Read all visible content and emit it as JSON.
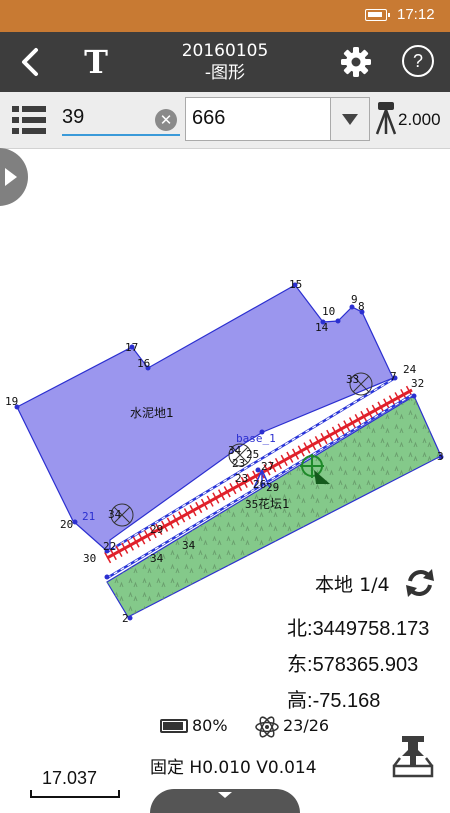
{
  "status_bar": {
    "time": "17:12"
  },
  "header": {
    "title_line1": "20160105",
    "title_line2": "-图形",
    "text_tool": "T",
    "help": "?"
  },
  "toolbar": {
    "point_name": "39",
    "code_value": "666",
    "instrument_height": "2.000"
  },
  "map": {
    "areas": [
      {
        "name": "水泥地1",
        "fill": "#9b96ee"
      },
      {
        "name": "花坛1",
        "fill": "#84c98a"
      }
    ],
    "point_labels": [
      "2",
      "3",
      "7",
      "8",
      "9",
      "10",
      "12",
      "13",
      "14",
      "15",
      "16",
      "17",
      "18",
      "19",
      "20",
      "21",
      "22",
      "23",
      "24",
      "25",
      "26",
      "27",
      "29",
      "30",
      "31",
      "32",
      "33",
      "34",
      "35"
    ],
    "base_label": "base_1",
    "colors": {
      "building": "#9b96ee",
      "garden": "#84c98a",
      "red_line": "#e0202a",
      "blue_line": "#2a36d8",
      "point": "#2b2fd0"
    }
  },
  "position": {
    "mode_label": "本地",
    "page": "1/4",
    "north_label": "北",
    "north": "3449758.173",
    "east_label": "东",
    "east": "578365.903",
    "height_label": "高",
    "height": "-75.168"
  },
  "device": {
    "battery": "80%",
    "satellites": "23/26",
    "solution_label": "固定",
    "precision": "H0.010 V0.014"
  },
  "scale": {
    "value": "17.037"
  }
}
